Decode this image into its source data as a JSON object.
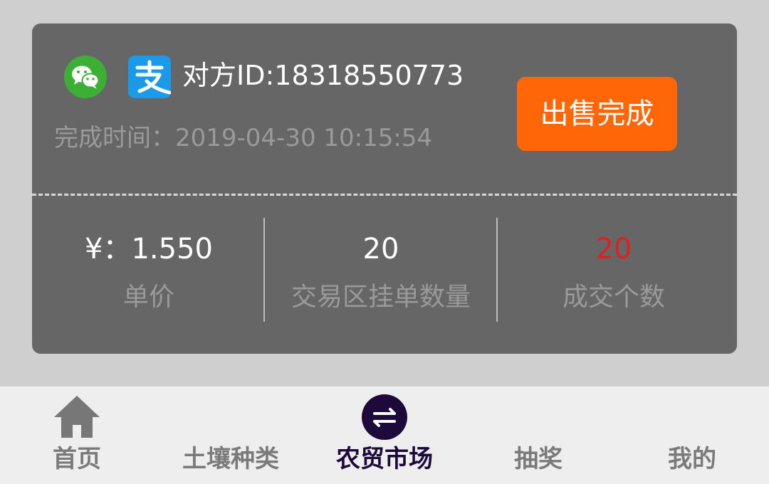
{
  "order": {
    "peer_id": "对方ID:18318550773",
    "complete_time": "完成时间：2019-04-30 10:15:54",
    "status_button": "出售完成",
    "payment_icons": [
      "wechat-icon",
      "alipay-icon"
    ],
    "stats": [
      {
        "value": "¥：1.550",
        "label": "单价"
      },
      {
        "value": "20",
        "label": "交易区挂单数量"
      },
      {
        "value": "20",
        "label": "成交个数",
        "color": "#e02020"
      }
    ]
  },
  "tabbar": {
    "tabs": [
      {
        "label": "首页",
        "icon": "home-icon"
      },
      {
        "label": "土壤种类"
      },
      {
        "label": "农贸市场",
        "icon": "exchange-icon",
        "active": true
      },
      {
        "label": "抽奖"
      },
      {
        "label": "我的"
      }
    ]
  },
  "colors": {
    "card_bg": "#666666",
    "page_bg": "#cfcfcf",
    "accent_orange": "#ff6608",
    "active_tab": "#1d0a3a",
    "highlight_red": "#e02020"
  }
}
